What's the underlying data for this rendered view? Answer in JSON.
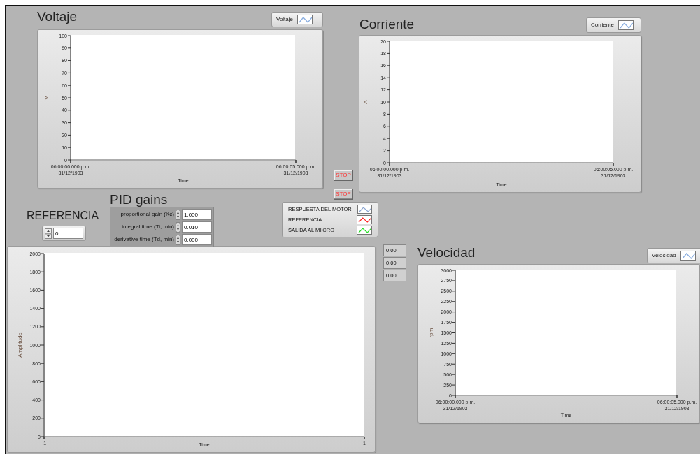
{
  "graphs": [
    {
      "title": "Voltaje",
      "chart_data": {
        "type": "line",
        "xlabel": "Time",
        "ylabel": "V",
        "ylim": [
          0,
          100
        ],
        "yticks": [
          0,
          10,
          20,
          30,
          40,
          50,
          60,
          70,
          80,
          90,
          100
        ],
        "categories": [
          "06:00:00.000 p.m.\n31/12/1903",
          "06:00:05.000 p.m.\n31/12/1903"
        ],
        "series": [
          {
            "name": "Voltaje",
            "color": "#8aaee0",
            "values": [
              null,
              null
            ]
          }
        ]
      }
    },
    {
      "title": "Corriente",
      "chart_data": {
        "type": "line",
        "xlabel": "Time",
        "ylabel": "A",
        "ylim": [
          0,
          20
        ],
        "yticks": [
          0,
          2,
          4,
          6,
          8,
          10,
          12,
          14,
          16,
          18,
          20
        ],
        "categories": [
          "06:00:00.000 p.m.\n31/12/1903",
          "06:00:05.000 p.m.\n31/12/1903"
        ],
        "series": [
          {
            "name": "Corriente",
            "color": "#8aaee0",
            "values": [
              null,
              null
            ]
          }
        ]
      }
    },
    {
      "chart_data": {
        "type": "line",
        "xlabel": "Time",
        "ylabel": "Amplitude",
        "ylim": [
          0,
          2000
        ],
        "yticks": [
          0,
          200,
          400,
          600,
          800,
          1000,
          1200,
          1400,
          1600,
          1800,
          2000
        ],
        "categories": [
          "-1",
          "1"
        ],
        "series": [
          {
            "name": "RESPUESTA DEL MOTOR",
            "color": "#8aa4d0",
            "values": [
              null,
              null
            ]
          },
          {
            "name": "REFERENCIA",
            "color": "#ff2424",
            "values": [
              null,
              null
            ]
          },
          {
            "name": "SALIDA AL  MIICRO",
            "color": "#22dd22",
            "values": [
              null,
              null
            ]
          }
        ]
      }
    },
    {
      "title": "Velocidad",
      "chart_data": {
        "type": "line",
        "xlabel": "Time",
        "ylabel": "rpm",
        "ylim": [
          0,
          3000
        ],
        "yticks": [
          0,
          250,
          500,
          750,
          1000,
          1250,
          1500,
          1750,
          2000,
          2250,
          2500,
          2750,
          3000
        ],
        "categories": [
          "06:00:00.000 p.m.\n31/12/1903",
          "06:00:05.000 p.m.\n31/12/1903"
        ],
        "series": [
          {
            "name": "Velocidad",
            "color": "#8aaee0",
            "values": [
              null,
              null
            ]
          }
        ]
      }
    }
  ],
  "stop_buttons": [
    "STOP",
    "STOP"
  ],
  "pid_gains": {
    "title": "PID gains",
    "fields": [
      {
        "label": "proportional gain (Kc)",
        "value": "1.000"
      },
      {
        "label": "integral time (Ti, min)",
        "value": "0.010"
      },
      {
        "label": "derivative time (Td, min)",
        "value": "0.000"
      }
    ]
  },
  "referencia": {
    "label": "REFERENCIA",
    "value": "0"
  },
  "indicators": [
    "0.00",
    "0.00",
    "0.00"
  ]
}
